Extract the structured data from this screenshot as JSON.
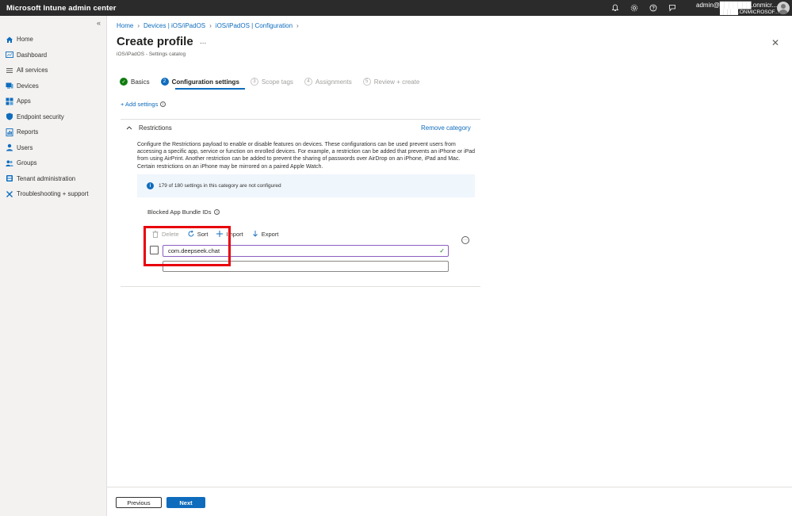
{
  "app": {
    "title": "Microsoft Intune admin center"
  },
  "header": {
    "account_line1": "admin@███████.onmicr...",
    "account_line2": "█████.ONMICROSOF...",
    "icons": [
      "bell-icon",
      "gear-icon",
      "help-icon",
      "feedback-icon"
    ]
  },
  "sidebar": {
    "items": [
      {
        "label": "Home",
        "icon": "home-icon",
        "color": "#0f6cbd"
      },
      {
        "label": "Dashboard",
        "icon": "dashboard-icon",
        "color": "#0f6cbd"
      },
      {
        "label": "All services",
        "icon": "list-icon",
        "color": "#605e5c"
      },
      {
        "label": "Devices",
        "icon": "devices-icon",
        "color": "#0f6cbd"
      },
      {
        "label": "Apps",
        "icon": "apps-icon",
        "color": "#0f6cbd"
      },
      {
        "label": "Endpoint security",
        "icon": "shield-icon",
        "color": "#0f6cbd"
      },
      {
        "label": "Reports",
        "icon": "reports-icon",
        "color": "#0f6cbd"
      },
      {
        "label": "Users",
        "icon": "users-icon",
        "color": "#0f6cbd"
      },
      {
        "label": "Groups",
        "icon": "groups-icon",
        "color": "#0f6cbd"
      },
      {
        "label": "Tenant administration",
        "icon": "tenant-icon",
        "color": "#0f6cbd"
      },
      {
        "label": "Troubleshooting + support",
        "icon": "wrench-icon",
        "color": "#0f6cbd"
      }
    ]
  },
  "breadcrumb": [
    "Home",
    "Devices | iOS/iPadOS",
    "iOS/iPadOS | Configuration"
  ],
  "page": {
    "title": "Create profile",
    "more": "...",
    "subtitle": "iOS/iPadOS - Settings catalog"
  },
  "steps": [
    {
      "num": "✓",
      "label": "Basics",
      "state": "done"
    },
    {
      "num": "2",
      "label": "Configuration settings",
      "state": "active"
    },
    {
      "num": "3",
      "label": "Scope tags",
      "state": "pending"
    },
    {
      "num": "4",
      "label": "Assignments",
      "state": "pending"
    },
    {
      "num": "5",
      "label": "Review + create",
      "state": "pending"
    }
  ],
  "add_settings": "+ Add settings",
  "category": {
    "name": "Restrictions",
    "remove_label": "Remove category",
    "description": "Configure the Restrictions payload to enable or disable features on devices. These configurations can be used prevent users from accessing a specific app, service or function on enrolled devices. For example, a restriction can be added that prevents an iPhone or iPad from using AirPrint. Another restriction can be added to prevent the sharing of passwords over AirDrop on an iPhone, iPad and Mac. Certain restrictions on an iPhone may be mirrored on a paired Apple Watch.",
    "info": "179 of 180 settings in this category are not configured"
  },
  "blocked": {
    "label": "Blocked App Bundle IDs",
    "toolbar": {
      "delete": "Delete",
      "sort": "Sort",
      "import": "Import",
      "export": "Export"
    },
    "entries": [
      "com.deepseek.chat"
    ],
    "new_entry": ""
  },
  "footer": {
    "previous": "Previous",
    "next": "Next"
  }
}
